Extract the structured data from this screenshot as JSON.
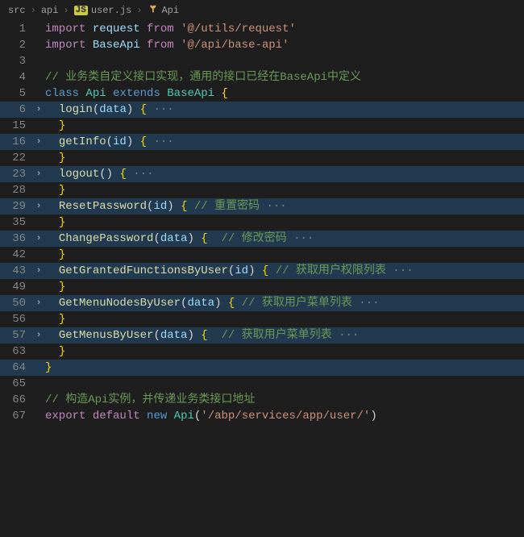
{
  "breadcrumb": {
    "seg1": "src",
    "seg2": "api",
    "seg3": "user.js",
    "seg4": "Api"
  },
  "lines": {
    "l1": {
      "no": "1",
      "import": "import",
      "ident": "request",
      "from": "from",
      "str": "'@/utils/request'"
    },
    "l2": {
      "no": "2",
      "import": "import",
      "ident": "BaseApi",
      "from": "from",
      "str": "'@/api/base-api'"
    },
    "l3": {
      "no": "3"
    },
    "l4": {
      "no": "4",
      "comment": "// 业务类自定义接口实现，通用的接口已经在BaseApi中定义"
    },
    "l5": {
      "no": "5",
      "class": "class",
      "name": "Api",
      "extends": "extends",
      "base": "BaseApi",
      "brace": "{"
    },
    "l6": {
      "no": "6",
      "fn": "login",
      "param": "data",
      "brace": "{",
      "dots": " ···"
    },
    "l15": {
      "no": "15",
      "brace": "}"
    },
    "l16": {
      "no": "16",
      "fn": "getInfo",
      "param": "id",
      "brace": "{",
      "dots": " ···"
    },
    "l22": {
      "no": "22",
      "brace": "}"
    },
    "l23": {
      "no": "23",
      "fn": "logout",
      "param": "",
      "brace": "{",
      "dots": " ···"
    },
    "l28": {
      "no": "28",
      "brace": "}"
    },
    "l29": {
      "no": "29",
      "fn": "ResetPassword",
      "param": "id",
      "brace": "{",
      "comment": " // 重置密码",
      "dots": " ···"
    },
    "l35": {
      "no": "35",
      "brace": "}"
    },
    "l36": {
      "no": "36",
      "fn": "ChangePassword",
      "param": "data",
      "brace": "{",
      "comment": "  // 修改密码",
      "dots": " ···"
    },
    "l42": {
      "no": "42",
      "brace": "}"
    },
    "l43": {
      "no": "43",
      "fn": "GetGrantedFunctionsByUser",
      "param": "id",
      "brace": "{",
      "comment": " // 获取用户权限列表",
      "dots": " ···"
    },
    "l49": {
      "no": "49",
      "brace": "}"
    },
    "l50": {
      "no": "50",
      "fn": "GetMenuNodesByUser",
      "param": "data",
      "brace": "{",
      "comment": " // 获取用户菜单列表",
      "dots": " ···"
    },
    "l56": {
      "no": "56",
      "brace": "}"
    },
    "l57": {
      "no": "57",
      "fn": "GetMenusByUser",
      "param": "data",
      "brace": "{",
      "comment": "  // 获取用户菜单列表",
      "dots": " ···"
    },
    "l63": {
      "no": "63",
      "brace": "}"
    },
    "l64": {
      "no": "64",
      "brace": "}"
    },
    "l65": {
      "no": "65"
    },
    "l66": {
      "no": "66",
      "comment": "// 构造Api实例，并传递业务类接口地址"
    },
    "l67": {
      "no": "67",
      "export": "export",
      "default": "default",
      "new": "new",
      "type": "Api",
      "str": "'/abp/services/app/user/'"
    }
  },
  "glyphs": {
    "chevron": "›",
    "fold": "›"
  }
}
